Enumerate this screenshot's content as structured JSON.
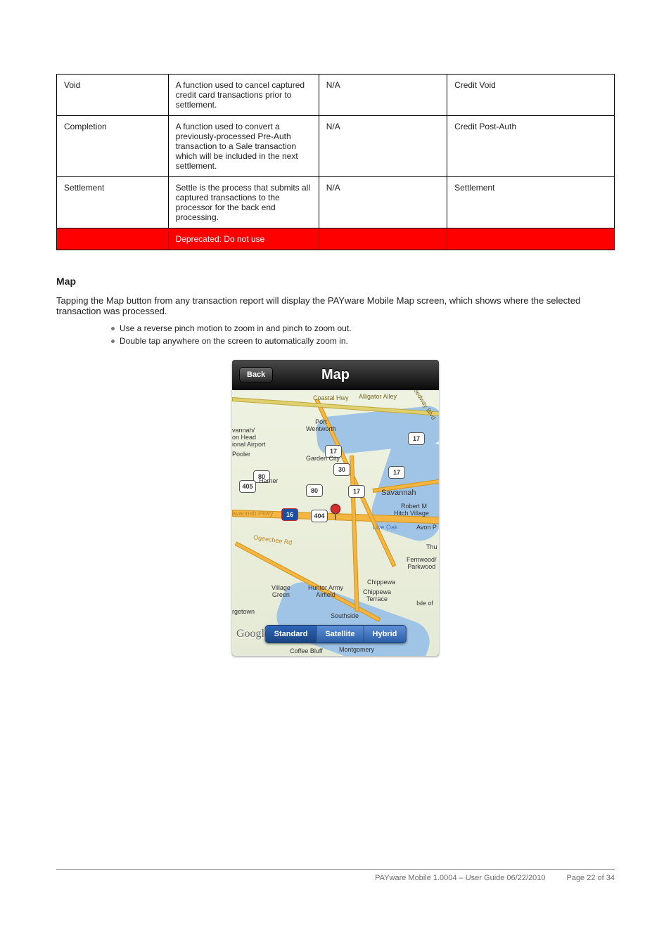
{
  "table": {
    "rows": [
      {
        "c1": "Void",
        "c2": "A function used to cancel captured credit card transactions prior to settlement.",
        "c3": "N/A",
        "c4": "Credit Void"
      },
      {
        "c1": "Completion",
        "c2": "A function used to convert a previously-processed Pre-Auth transaction to a Sale transaction which will be included in the next settlement.",
        "c3": "N/A",
        "c4": "Credit Post-Auth"
      },
      {
        "c1": "Settlement",
        "c2": "Settle is the process that submits all captured transactions to the processor for the back end processing.",
        "c3": "N/A",
        "c4": "Settlement"
      }
    ],
    "total_row": {
      "c1": "",
      "c2": "Deprecated: Do not use",
      "c3": "",
      "c4": ""
    }
  },
  "section": {
    "heading": "Map",
    "intro": "Tapping the Map button from any transaction report will display the PAYware Mobile Map screen, which shows where the selected transaction was processed.",
    "bullets": [
      "Use a reverse pinch motion to zoom in and pinch to zoom out.",
      "Double tap anywhere on the screen to automatically zoom in."
    ]
  },
  "phone": {
    "back": "Back",
    "title": "Map",
    "segments": [
      "Standard",
      "Satellite",
      "Hybrid"
    ],
    "active_segment": 0,
    "brand": "Google",
    "shields": {
      "s80a": "80",
      "s405": "405",
      "s80b": "80",
      "s17a": "17",
      "s30": "30",
      "s17b": "17",
      "s404": "404",
      "s17c": "17",
      "s17d": "17",
      "i16": "16"
    },
    "labels": {
      "coastal": "Coastal Hwy",
      "alligator": "Alligator Alley",
      "speedway": "Speedway Blvd",
      "portw": "Port\nWentworth",
      "airport1": "vannah/",
      "airport2": "on Head",
      "airport3": "ional Airport",
      "pooler": "Pooler",
      "harner": "Harner",
      "garden": "Garden City",
      "savpkwy": "avannah Pkwy",
      "savannah": "Savannah",
      "hitch1": "Robert M",
      "hitch2": "Hitch Village",
      "liveoak": "Live Oak",
      "avon": "Avon P",
      "ogeechee": "Ogeechee Rd",
      "thu": "Thu",
      "fern": "Fernwood/\nParkwood",
      "vgreen": "Village\nGreen",
      "hunter": "Hunter Army\nAirfield",
      "chip1": "Chippewa",
      "chip2": "Chippewa\nTerrace",
      "isle": "Isle of",
      "rget": "rgetown",
      "southside": "Southside",
      "coffee": "Coffee Bluff",
      "montg": "Montgomery"
    }
  },
  "footer": {
    "left": "PAYware Mobile 1.0004 – User Guide 06/22/2010",
    "right": "Page 22 of 34"
  }
}
